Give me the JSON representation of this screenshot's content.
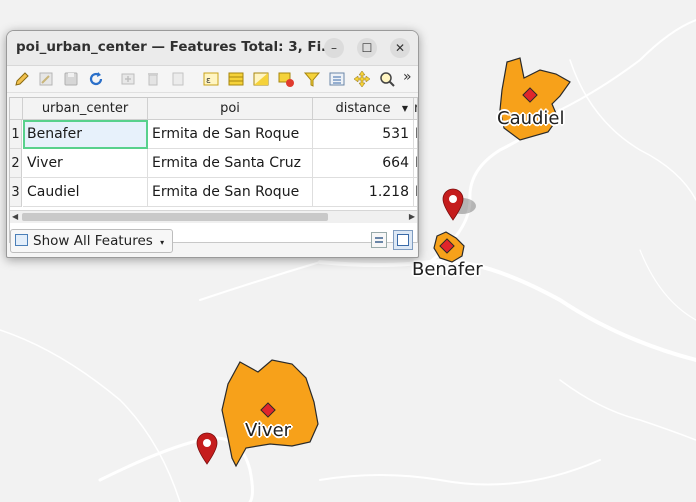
{
  "window": {
    "title": "poi_urban_center — Features Total: 3, Fi…",
    "minimize": "–",
    "maximize": "☐",
    "close": "✕"
  },
  "toolbar": {
    "more": "»",
    "icons": [
      "toggle-edit-icon",
      "multi-edit-icon",
      "save-edits-icon",
      "reload-icon",
      "add-feature-icon",
      "delete-feature-icon",
      "cut-icon",
      "expression-select-icon",
      "select-all-icon",
      "invert-selection-icon",
      "deselect-icon",
      "filter-icon",
      "move-selection-top-icon",
      "pan-to-selection-icon",
      "zoom-to-selection-icon"
    ]
  },
  "table": {
    "columns": [
      "urban_center",
      "poi",
      "distance",
      "r"
    ],
    "rows": [
      {
        "num": "1",
        "urban_center": "Benafer",
        "poi": "Ermita de San Roque",
        "distance": "531",
        "extra": "I"
      },
      {
        "num": "2",
        "urban_center": "Viver",
        "poi": "Ermita de Santa Cruz",
        "distance": "664",
        "extra": "I"
      },
      {
        "num": "3",
        "urban_center": "Caudiel",
        "poi": "Ermita de San Roque",
        "distance": "1.218",
        "extra": "I"
      }
    ]
  },
  "footer": {
    "show_all": "Show All Features"
  },
  "map": {
    "labels": {
      "caudiel": "Caudiel",
      "benafer": "Benafer",
      "viver": "Viver"
    },
    "colors": {
      "polygon_fill": "#f7a11a",
      "polygon_stroke": "#2a2a2a",
      "centroid": "#e0262b",
      "marker": "#c51d1d",
      "road": "#ffffff",
      "background": "#f2f2f2"
    }
  }
}
